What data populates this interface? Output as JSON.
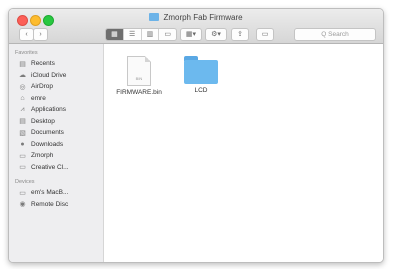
{
  "window": {
    "title": "Zmorph Fab Firmware"
  },
  "toolbar": {
    "back": "‹",
    "forward": "›",
    "views": [
      "▦",
      "☰",
      "▥",
      "▭"
    ],
    "arrange": "▦▾",
    "action": "⚙▾",
    "share": "⇪",
    "tag": "▭",
    "search_placeholder": "Q Search"
  },
  "sidebar": {
    "favorites_header": "Favorites",
    "favorites": [
      {
        "label": "Recents",
        "icon": "clock-list-icon"
      },
      {
        "label": "iCloud Drive",
        "icon": "cloud-icon"
      },
      {
        "label": "AirDrop",
        "icon": "airdrop-icon"
      },
      {
        "label": "emre",
        "icon": "home-icon"
      },
      {
        "label": "Applications",
        "icon": "applications-icon"
      },
      {
        "label": "Desktop",
        "icon": "desktop-icon"
      },
      {
        "label": "Documents",
        "icon": "documents-icon"
      },
      {
        "label": "Downloads",
        "icon": "downloads-icon"
      },
      {
        "label": "Zmorph",
        "icon": "folder-icon"
      },
      {
        "label": "Creative Cl...",
        "icon": "folder-icon"
      }
    ],
    "devices_header": "Devices",
    "devices": [
      {
        "label": "em's MacB...",
        "icon": "laptop-icon"
      },
      {
        "label": "Remote Disc",
        "icon": "disc-icon"
      }
    ]
  },
  "files": [
    {
      "name": "FIRMWARE.bin",
      "kind": "document",
      "ext": "BIN"
    },
    {
      "name": "LCD",
      "kind": "folder"
    }
  ],
  "colors": {
    "close": "#fc5f57",
    "minimize": "#fdbc2e",
    "maximize": "#28c840",
    "folder": "#6cb9ee"
  }
}
